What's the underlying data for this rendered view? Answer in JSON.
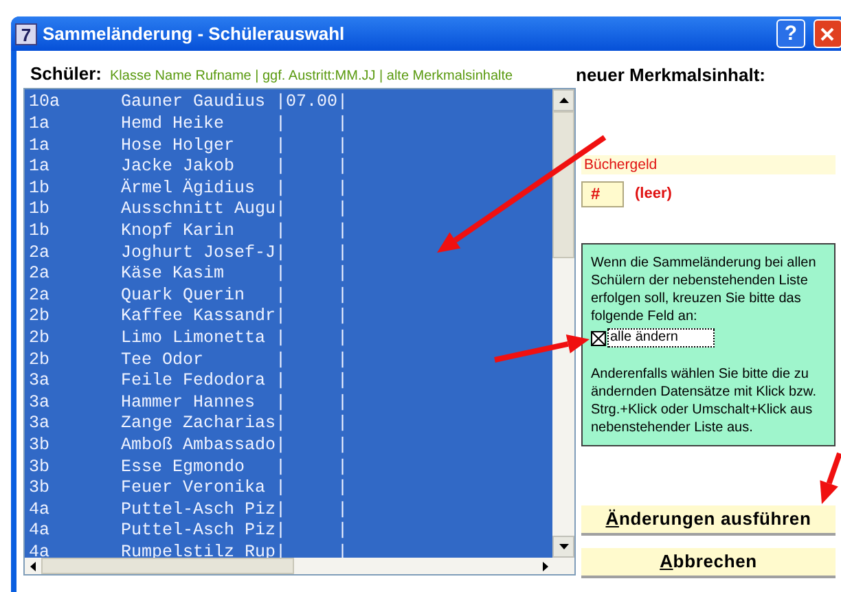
{
  "window": {
    "icon_text": "7",
    "title": "Sammeländerung - Schülerauswahl",
    "help": "?"
  },
  "list_header": {
    "label": "Schüler:",
    "columns_hint": "Klasse Name Rufname | ggf. Austritt:MM.JJ | alte Merkmalsinhalte"
  },
  "students": [
    {
      "class": "10a",
      "entry": "Gauner Gaudius |07.00|",
      "selected": true
    },
    {
      "class": "1a",
      "entry": "Hemd Heike     |     |",
      "selected": true
    },
    {
      "class": "1a",
      "entry": "Hose Holger    |     |",
      "selected": true
    },
    {
      "class": "1a",
      "entry": "Jacke Jakob    |     |",
      "selected": true
    },
    {
      "class": "1b",
      "entry": "Ärmel Ägidius  |     |",
      "selected": true
    },
    {
      "class": "1b",
      "entry": "Ausschnitt Augu|     |",
      "selected": true
    },
    {
      "class": "1b",
      "entry": "Knopf Karin    |     |",
      "selected": true
    },
    {
      "class": "2a",
      "entry": "Joghurt Josef-J|     |",
      "selected": true
    },
    {
      "class": "2a",
      "entry": "Käse Kasim     |     |",
      "selected": true
    },
    {
      "class": "2a",
      "entry": "Quark Querin   |     |",
      "selected": true
    },
    {
      "class": "2b",
      "entry": "Kaffee Kassandr|     |",
      "selected": true
    },
    {
      "class": "2b",
      "entry": "Limo Limonetta |     |",
      "selected": true
    },
    {
      "class": "2b",
      "entry": "Tee Odor       |     |",
      "selected": true
    },
    {
      "class": "3a",
      "entry": "Feile Fedodora |     |",
      "selected": true
    },
    {
      "class": "3a",
      "entry": "Hammer Hannes  |     |",
      "selected": true
    },
    {
      "class": "3a",
      "entry": "Zange Zacharias|     |",
      "selected": true
    },
    {
      "class": "3b",
      "entry": "Amboß Ambassado|     |",
      "selected": true
    },
    {
      "class": "3b",
      "entry": "Esse Egmondo   |     |",
      "selected": true
    },
    {
      "class": "3b",
      "entry": "Feuer Veronika |     |",
      "selected": true
    },
    {
      "class": "4a",
      "entry": "Puttel-Asch Piz|     |",
      "selected": true
    },
    {
      "class": "4a",
      "entry": "Puttel-Asch Piz|     |",
      "selected": true
    },
    {
      "class": "4a",
      "entry": "Rumpelstilz Rup|     |",
      "selected": true
    }
  ],
  "right_panel": {
    "heading": "neuer Merkmalsinhalt:",
    "attribute": "Büchergeld",
    "value": "#",
    "value_hint": "(leer)",
    "info_text": "Wenn die Sammeländerung bei allen Schülern der nebenstehenden Liste erfolgen soll, kreuzen Sie bitte das folgende Feld an:",
    "checkbox": {
      "label": "alle ändern",
      "checked": true
    },
    "info_text_2": "Anderenfalls wählen Sie bitte die zu ändernden Datensätze mit Klick bzw. Strg.+Klick oder Umschalt+Klick aus nebenstehender Liste  aus."
  },
  "buttons": [
    "Änderungen ausführen",
    "Abbrechen"
  ]
}
